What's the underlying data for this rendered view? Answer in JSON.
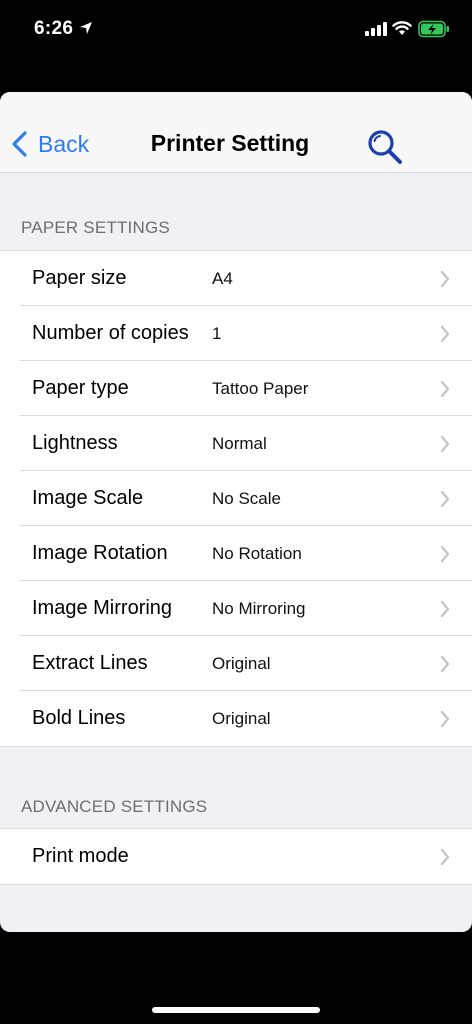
{
  "status_bar": {
    "time": "6:26"
  },
  "nav": {
    "back_label": "Back",
    "title": "Printer Setting"
  },
  "colors": {
    "accent": "#2f7cf6",
    "search_icon": "#1c3fae",
    "battery": "#35c759"
  },
  "sections": [
    {
      "header": "PAPER SETTINGS",
      "rows": [
        {
          "label": "Paper size",
          "value": "A4"
        },
        {
          "label": "Number of copies",
          "value": "1"
        },
        {
          "label": "Paper type",
          "value": "Tattoo Paper"
        },
        {
          "label": "Lightness",
          "value": "Normal"
        },
        {
          "label": "Image Scale",
          "value": "No Scale"
        },
        {
          "label": "Image Rotation",
          "value": "No Rotation"
        },
        {
          "label": "Image Mirroring",
          "value": "No Mirroring"
        },
        {
          "label": "Extract Lines",
          "value": "Original"
        },
        {
          "label": "Bold Lines",
          "value": "Original"
        }
      ]
    },
    {
      "header": "ADVANCED SETTINGS",
      "rows": [
        {
          "label": "Print mode",
          "value": ""
        }
      ]
    }
  ]
}
